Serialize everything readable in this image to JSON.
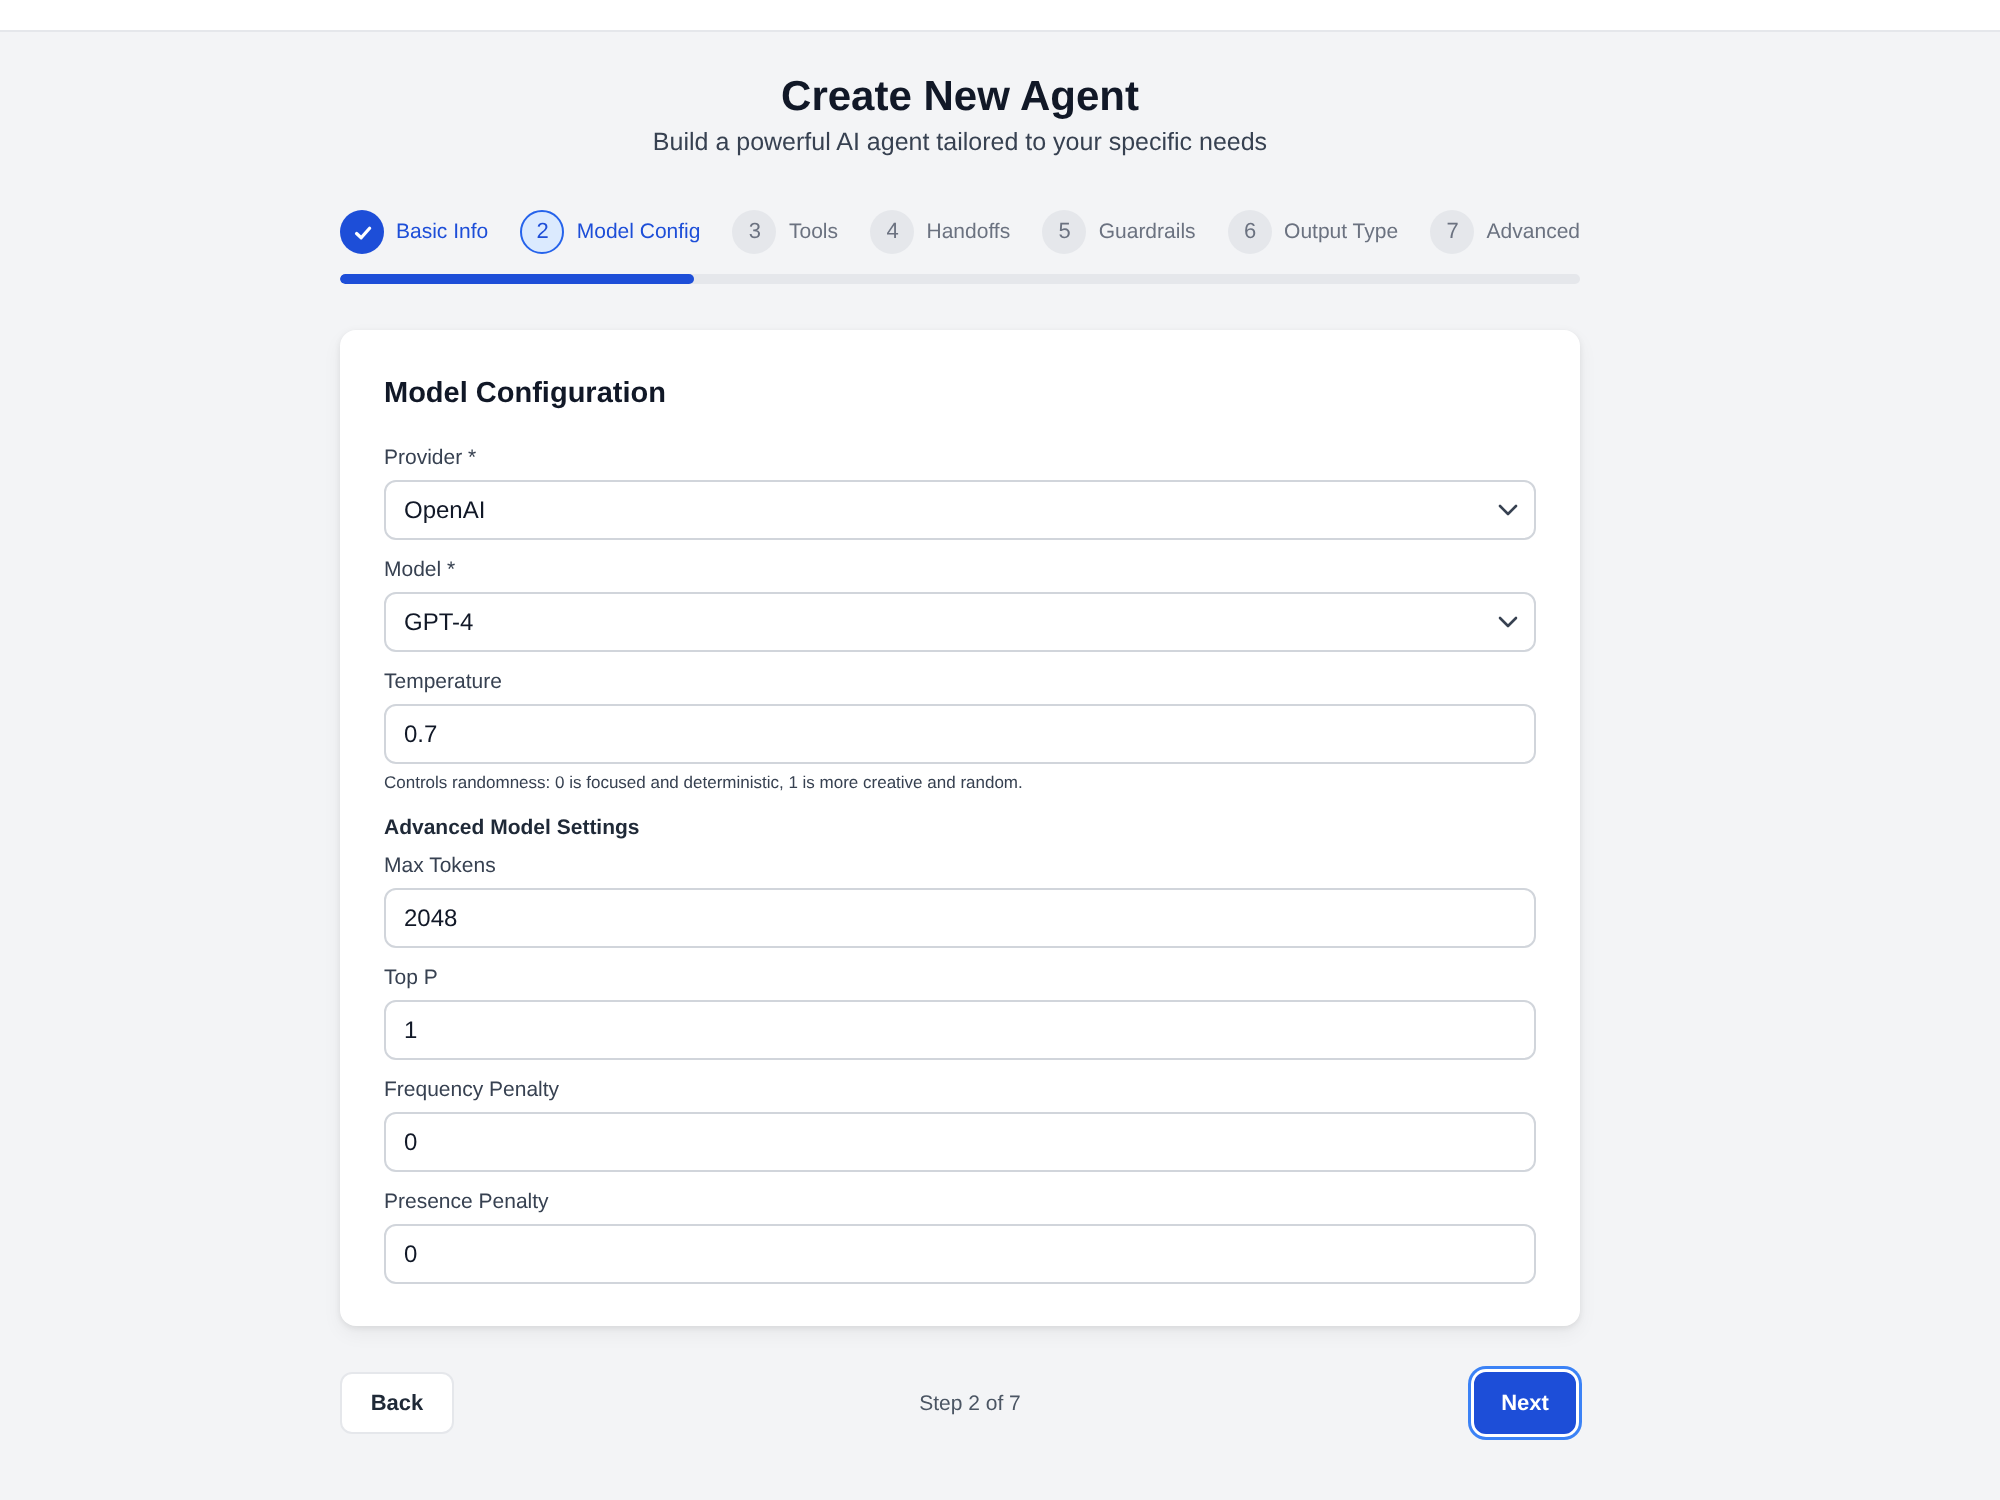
{
  "header": {
    "title": "Create New Agent",
    "subtitle": "Build a powerful AI agent tailored to your specific needs"
  },
  "steps": [
    {
      "label": "Basic Info",
      "completed": true,
      "selected": false
    },
    {
      "number": "2",
      "label": "Model Config",
      "completed": false,
      "selected": true
    },
    {
      "number": "3",
      "label": "Tools",
      "completed": false,
      "selected": false
    },
    {
      "number": "4",
      "label": "Handoffs",
      "completed": false,
      "selected": false
    },
    {
      "number": "5",
      "label": "Guardrails",
      "completed": false,
      "selected": false
    },
    {
      "number": "6",
      "label": "Output Type",
      "completed": false,
      "selected": false
    },
    {
      "number": "7",
      "label": "Advanced",
      "completed": false,
      "selected": false
    }
  ],
  "progress": {
    "level": 0.2857
  },
  "card": {
    "title": "Model Configuration",
    "fields": [
      {
        "kind": "select",
        "label": "Provider *",
        "value": "OpenAI"
      },
      {
        "kind": "select",
        "label": "Model *",
        "value": "GPT-4"
      },
      {
        "kind": "input",
        "label": "Temperature",
        "value": "0.7",
        "help": "Controls randomness: 0 is focused and deterministic, 1 is more creative and random."
      }
    ],
    "advanced": {
      "title": "Advanced Model Settings",
      "fields": [
        {
          "kind": "input",
          "label": "Max Tokens",
          "value": "2048"
        },
        {
          "kind": "input",
          "label": "Top P",
          "value": "1"
        },
        {
          "kind": "input",
          "label": "Frequency Penalty",
          "value": "0"
        },
        {
          "kind": "input",
          "label": "Presence Penalty",
          "value": "0"
        }
      ]
    }
  },
  "footer": {
    "back": {
      "kind": "secondary",
      "label": "Back",
      "focused": false
    },
    "status": "Step 2 of 7",
    "next": {
      "kind": "primary",
      "label": "Next",
      "focused": true
    }
  }
}
